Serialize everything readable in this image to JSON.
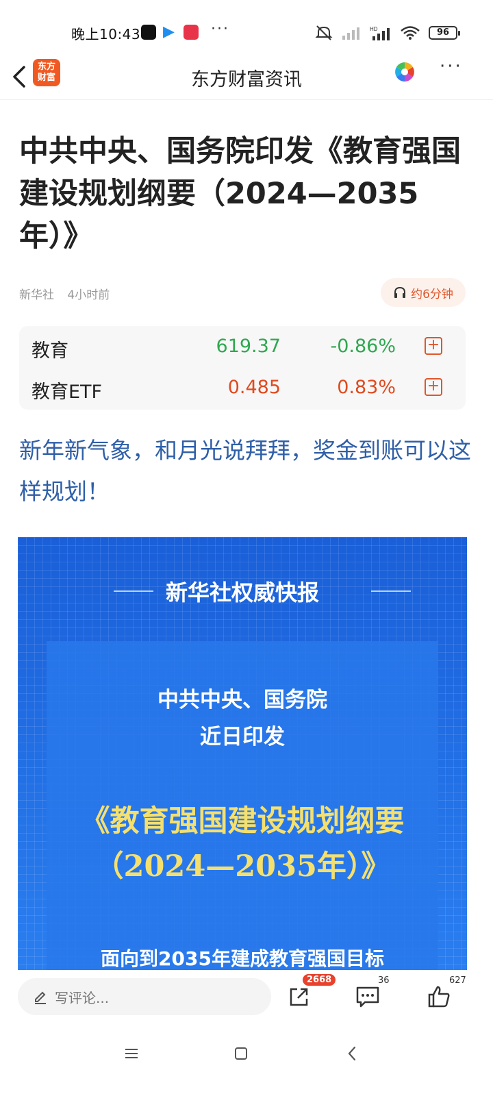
{
  "status_bar": {
    "time": "晚上10:43",
    "battery": "96",
    "more": "···"
  },
  "nav": {
    "title": "东方财富资讯",
    "logo_line1": "东方",
    "logo_line2": "财富",
    "more": "···"
  },
  "article": {
    "headline": "中共中央、国务院印发《教育强国建设规划纲要（2024—2035年）》",
    "source": "新华社",
    "time_ago": "4小时前",
    "listen_label": "约6分钟"
  },
  "quotes": [
    {
      "name": "教育",
      "price": "619.37",
      "change": "-0.86%",
      "trend": "down"
    },
    {
      "name": "教育ETF",
      "price": "0.485",
      "change": "0.83%",
      "trend": "up"
    }
  ],
  "promo_link": "新年新气象，和月光说拜拜，奖金到账可以这样规划！",
  "banner": {
    "header": "新华社权威快报",
    "line1": "中共中央、国务院",
    "line2": "近日印发",
    "title_line1": "《教育强国建设规划纲要",
    "title_line2": "（2024—2035年）》",
    "bottom": "面向到2035年建成教育强国目标"
  },
  "bottom_bar": {
    "comment_placeholder": "写评论...",
    "share_count": "2668",
    "comment_count": "36",
    "like_count": "627"
  },
  "colors": {
    "brand": "#f05a22",
    "up": "#e04a1f",
    "down": "#2fa84f",
    "link": "#2f5fa8",
    "banner_blue": "#1e6be0",
    "banner_gold": "#f5e06e"
  }
}
